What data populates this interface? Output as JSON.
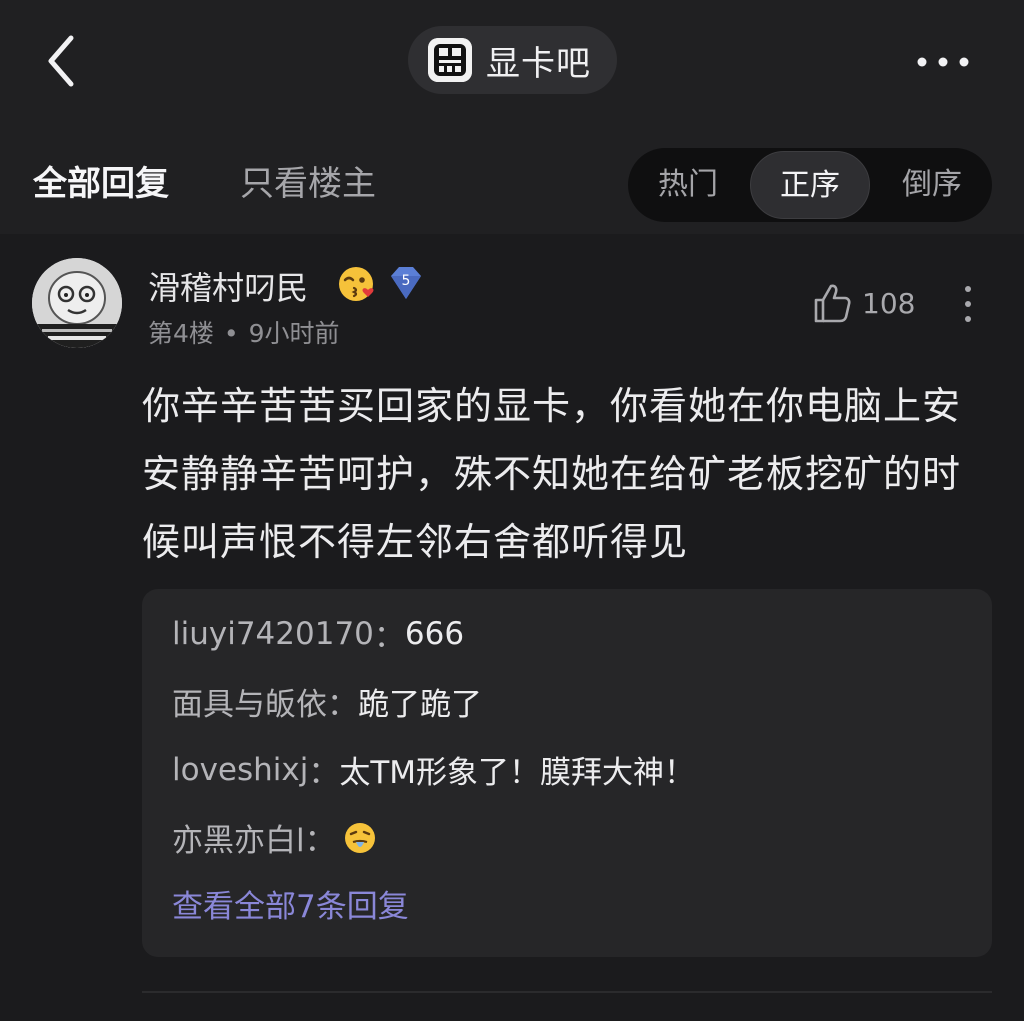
{
  "header": {
    "forum_name": "显卡吧",
    "back_icon": "chevron-left-icon",
    "more_icon": "ellipsis-icon"
  },
  "tabs": {
    "all_replies": "全部回复",
    "owner_only": "只看楼主"
  },
  "sort": {
    "hot": "热门",
    "ascending": "正序",
    "descending": "倒序",
    "selected": "正序"
  },
  "post": {
    "username": "滑稽村叼民",
    "level": "5",
    "floor": "第4楼",
    "dot": "•",
    "time": "9小时前",
    "likes": "108",
    "body": "你辛辛苦苦买回家的显卡，你看她在你电脑上安安静静辛苦呵护，殊不知她在给矿老板挖矿的时候叫声恨不得左邻右舍都听得见"
  },
  "replies": {
    "items": [
      {
        "user": "liuyi7420170",
        "sep": "：",
        "text": "666"
      },
      {
        "user": "面具与皈依",
        "sep": "：",
        "text": "跪了跪了"
      },
      {
        "user": "loveshixj",
        "sep": "：",
        "text": "太TM形象了！膜拜大神！"
      },
      {
        "user": "亦黑亦白l",
        "sep": "：",
        "text": ""
      }
    ],
    "view_all": "查看全部7条回复"
  },
  "colors": {
    "background": "#1b1b1d",
    "header": "#202022",
    "link": "#8a87d8",
    "badge": "#5b7fd6"
  }
}
